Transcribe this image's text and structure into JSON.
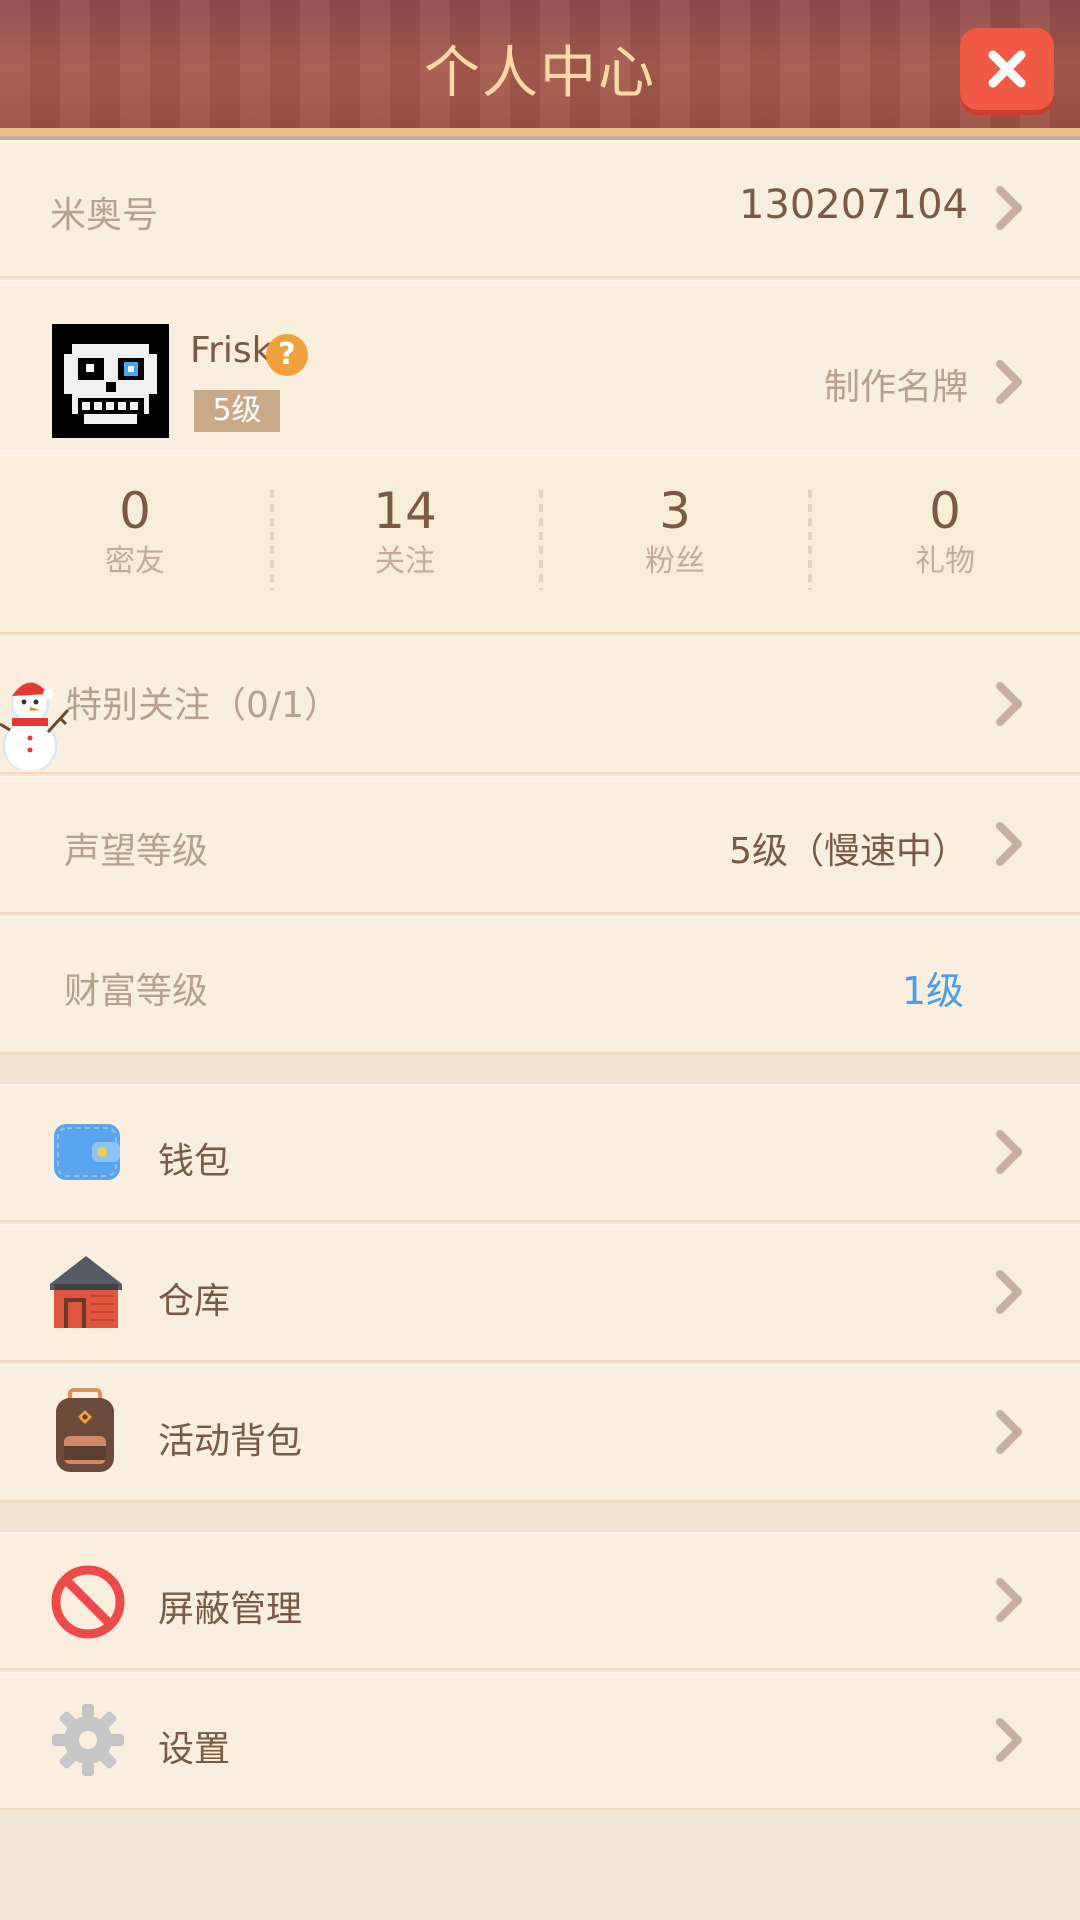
{
  "header": {
    "title": "个人中心"
  },
  "account": {
    "label": "米奥号",
    "value": "130207104"
  },
  "profile": {
    "username": "Frisk",
    "help_icon": "?",
    "level": "5级",
    "nameplate_label": "制作名牌"
  },
  "stats": [
    {
      "value": "0",
      "label": "密友"
    },
    {
      "value": "14",
      "label": "关注"
    },
    {
      "value": "3",
      "label": "粉丝"
    },
    {
      "value": "0",
      "label": "礼物"
    }
  ],
  "special_follow": {
    "label": "特别关注（0/1）"
  },
  "reputation": {
    "label": "声望等级",
    "value": "5级（慢速中）"
  },
  "wealth": {
    "label": "财富等级",
    "value": "1级"
  },
  "menu_group_1": [
    {
      "label": "钱包",
      "icon": "wallet-icon"
    },
    {
      "label": "仓库",
      "icon": "warehouse-icon"
    },
    {
      "label": "活动背包",
      "icon": "backpack-icon"
    }
  ],
  "menu_group_2": [
    {
      "label": "屏蔽管理",
      "icon": "block-icon"
    },
    {
      "label": "设置",
      "icon": "gear-icon"
    }
  ],
  "colors": {
    "accent_close": "#f05a44",
    "wealth_value": "#4a9ee8",
    "row_bg": "#faefdf",
    "header_text": "#ffd9a8"
  }
}
